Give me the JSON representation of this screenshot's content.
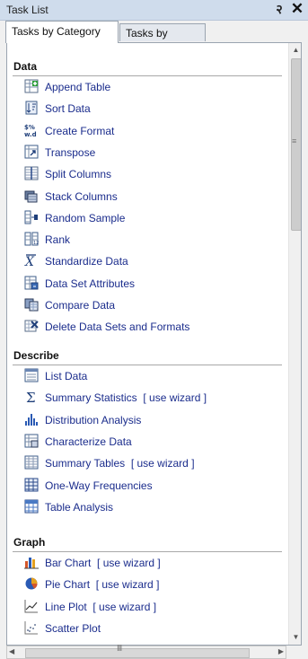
{
  "window": {
    "title": "Task List",
    "pin_glyph": "२",
    "close_glyph": "✕"
  },
  "tabs": [
    {
      "label": "Tasks by Category",
      "active": true
    },
    {
      "label": "Tasks by Name",
      "active": false
    }
  ],
  "sections": [
    {
      "title": "Data",
      "items": [
        {
          "label": "Append Table",
          "icon": "append-table-icon"
        },
        {
          "label": "Sort Data",
          "icon": "sort-data-icon"
        },
        {
          "label": "Create Format",
          "icon": "create-format-icon"
        },
        {
          "label": "Transpose",
          "icon": "transpose-icon"
        },
        {
          "label": "Split Columns",
          "icon": "split-columns-icon"
        },
        {
          "label": "Stack Columns",
          "icon": "stack-columns-icon"
        },
        {
          "label": "Random Sample",
          "icon": "random-sample-icon"
        },
        {
          "label": "Rank",
          "icon": "rank-icon"
        },
        {
          "label": "Standardize Data",
          "icon": "standardize-data-icon"
        },
        {
          "label": "Data Set Attributes",
          "icon": "data-set-attributes-icon"
        },
        {
          "label": "Compare Data",
          "icon": "compare-data-icon"
        },
        {
          "label": "Delete Data Sets and Formats",
          "icon": "delete-data-sets-icon"
        }
      ]
    },
    {
      "title": "Describe",
      "items": [
        {
          "label": "List Data",
          "icon": "list-data-icon"
        },
        {
          "label": "Summary Statistics",
          "wizard": "[ use wizard ]",
          "icon": "sigma-icon"
        },
        {
          "label": "Distribution Analysis",
          "icon": "distribution-analysis-icon"
        },
        {
          "label": "Characterize Data",
          "icon": "characterize-data-icon"
        },
        {
          "label": "Summary Tables",
          "wizard": "[ use wizard ]",
          "icon": "summary-tables-icon"
        },
        {
          "label": "One-Way Frequencies",
          "icon": "one-way-frequencies-icon"
        },
        {
          "label": "Table Analysis",
          "icon": "table-analysis-icon"
        }
      ]
    },
    {
      "title": "Graph",
      "items": [
        {
          "label": "Bar Chart",
          "wizard": "[ use wizard ]",
          "icon": "bar-chart-icon"
        },
        {
          "label": "Pie Chart",
          "wizard": "[ use wizard ]",
          "icon": "pie-chart-icon"
        },
        {
          "label": "Line Plot",
          "wizard": "[ use wizard ]",
          "icon": "line-plot-icon"
        },
        {
          "label": "Scatter Plot",
          "icon": "scatter-plot-icon"
        }
      ]
    }
  ],
  "scrollbar": {
    "up": "▲",
    "down": "▼",
    "left": "◀",
    "right": "▶",
    "grip_v": "≡",
    "grip_h": "III"
  },
  "colors": {
    "title_bar": "#cfdcec",
    "link": "#1a2c8c",
    "panel_bg": "#ffffff"
  }
}
